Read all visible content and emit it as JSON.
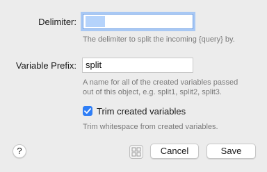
{
  "delimiter": {
    "label": "Delimiter:",
    "value": "",
    "help": "The delimiter to split the incoming {query} by."
  },
  "prefix": {
    "label": "Variable Prefix:",
    "value": "split",
    "help_line1": "A name for all of the created variables passed",
    "help_line2": "out of this object, e.g. split1, split2, split3."
  },
  "trim": {
    "label": "Trim created variables",
    "checked": true,
    "help": "Trim whitespace from created variables."
  },
  "footer": {
    "help_glyph": "?",
    "grid_icon": "grid-icon",
    "cancel_label": "Cancel",
    "save_label": "Save"
  },
  "colors": {
    "accent": "#2f7ef6",
    "focus_ring": "#a8c8f4",
    "background": "#ececec"
  }
}
